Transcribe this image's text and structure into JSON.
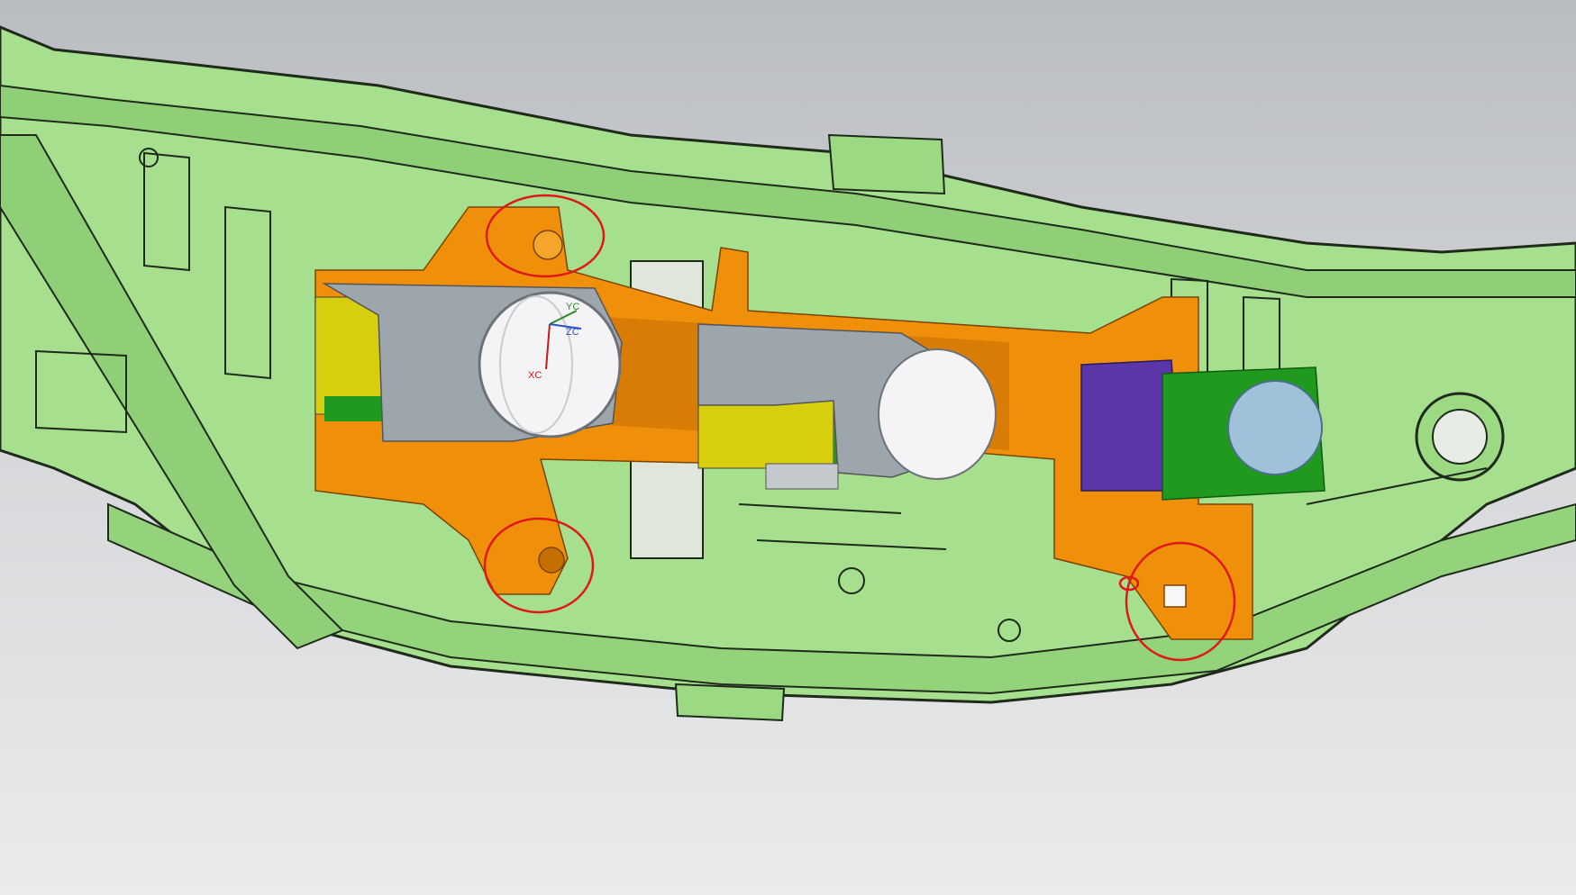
{
  "viewport": {
    "background_top": "#b9bcc1",
    "background_bottom": "#ebebec"
  },
  "colors": {
    "housing_green": "#a6e08f",
    "housing_green_dark": "#7fbf6a",
    "housing_edge": "#1f2a1a",
    "bracket_orange": "#f0900a",
    "bracket_orange_dark": "#c66f00",
    "lens_white": "#f4f4f6",
    "lens_blue": "#9fc2da",
    "module_gray": "#9ea6ad",
    "module_yellow": "#d7cf0e",
    "module_green": "#1f9a1f",
    "module_purple": "#5a36a8",
    "markup_red": "#e01818"
  },
  "csys": {
    "x_label": "XC",
    "y_label": "YC",
    "z_label": "ZC"
  },
  "annotations": [
    {
      "name": "markup-circle-top-left"
    },
    {
      "name": "markup-circle-bottom-left"
    },
    {
      "name": "markup-circle-bottom-right"
    },
    {
      "name": "markup-circle-small"
    }
  ]
}
